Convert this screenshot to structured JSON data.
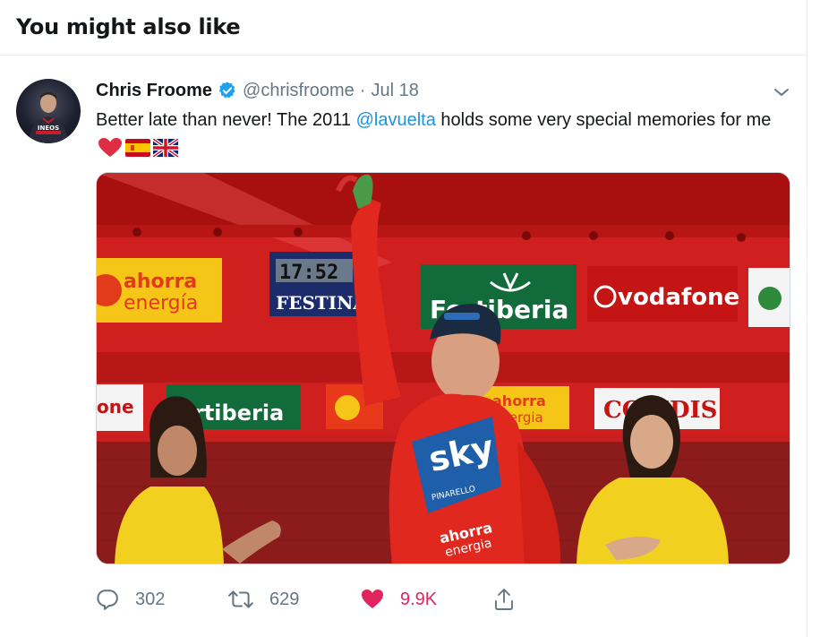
{
  "section": {
    "title": "You might also like"
  },
  "tweet": {
    "author": {
      "display_name": "Chris Froome",
      "handle": "@chrisfroome",
      "verified": true,
      "avatar_icon": "avatar-photo"
    },
    "separator": "·",
    "date": "Jul 18",
    "text_before": "Better late than never! The 2011 ",
    "mention": "@lavuelta",
    "text_after": " holds some very special memories for me ",
    "emojis": [
      "red-heart-icon",
      "spain-flag-icon",
      "uk-flag-icon"
    ],
    "media": {
      "sponsor_signs": [
        "ahorra energía",
        "FESTINA",
        "Fortiberia",
        "vodafone",
        "ahorra energia",
        "COFIDIS",
        "sky",
        "PINARELLO"
      ],
      "clock_reading": "17:52"
    },
    "actions": {
      "replies": "302",
      "retweets": "629",
      "likes": "9.9K",
      "liked": true
    }
  },
  "colors": {
    "link": "#1b95e0",
    "secondary_text": "#657786",
    "like_active": "#e0245e",
    "verified_badge": "#1da1f2"
  }
}
